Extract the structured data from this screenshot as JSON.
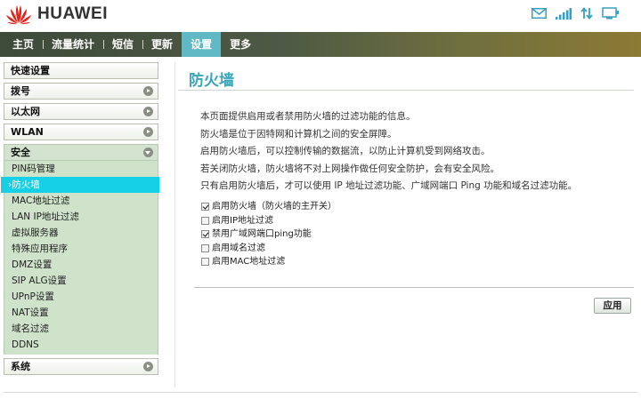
{
  "brand": {
    "name": "HUAWEI",
    "logo_color": "#e2231a"
  },
  "status_icons": [
    "mail-icon",
    "signal-icon",
    "data-transfer-icon",
    "monitor-icon"
  ],
  "nav": {
    "items": [
      {
        "label": "主页"
      },
      {
        "label": "流量统计"
      },
      {
        "label": "短信"
      },
      {
        "label": "更新"
      },
      {
        "label": "设置",
        "active": true
      },
      {
        "label": "更多"
      }
    ],
    "active_color": "#5fb8c4"
  },
  "sidebar": {
    "quick_setup": "快速设置",
    "dialup": "拨号",
    "ethernet": "以太网",
    "wlan": "WLAN",
    "security": {
      "label": "安全",
      "items": [
        {
          "label": "PIN码管理"
        },
        {
          "label": "防火墙",
          "active": true
        },
        {
          "label": "MAC地址过滤"
        },
        {
          "label": "LAN IP地址过滤"
        },
        {
          "label": "虚拟服务器"
        },
        {
          "label": "特殊应用程序"
        },
        {
          "label": "DMZ设置"
        },
        {
          "label": "SIP ALG设置"
        },
        {
          "label": "UPnP设置"
        },
        {
          "label": "NAT设置"
        },
        {
          "label": "域名过滤"
        },
        {
          "label": "DDNS"
        }
      ]
    },
    "system": "系统",
    "active_item_color": "#15d0e6"
  },
  "content": {
    "title": "防火墙",
    "description": [
      "本页面提供启用或者禁用防火墙的过滤功能的信息。",
      "防火墙是位于因特网和计算机之间的安全屏障。",
      "启用防火墙后，可以控制传输的数据流，以防止计算机受到网络攻击。",
      "若关闭防火墙，防火墙将不对上网操作做任何安全防护，会有安全风险。",
      "只有启用防火墙后，才可以使用 IP 地址过滤功能、广域网端口 Ping 功能和域名过滤功能。"
    ],
    "options": [
      {
        "label": "启用防火墙（防火墙的主开关）",
        "checked": true
      },
      {
        "label": "启用IP地址过滤",
        "checked": false
      },
      {
        "label": "禁用广域网端口ping功能",
        "checked": true
      },
      {
        "label": "启用域名过滤",
        "checked": false
      },
      {
        "label": "启用MAC地址过滤",
        "checked": false
      }
    ],
    "apply_label": "应用"
  }
}
